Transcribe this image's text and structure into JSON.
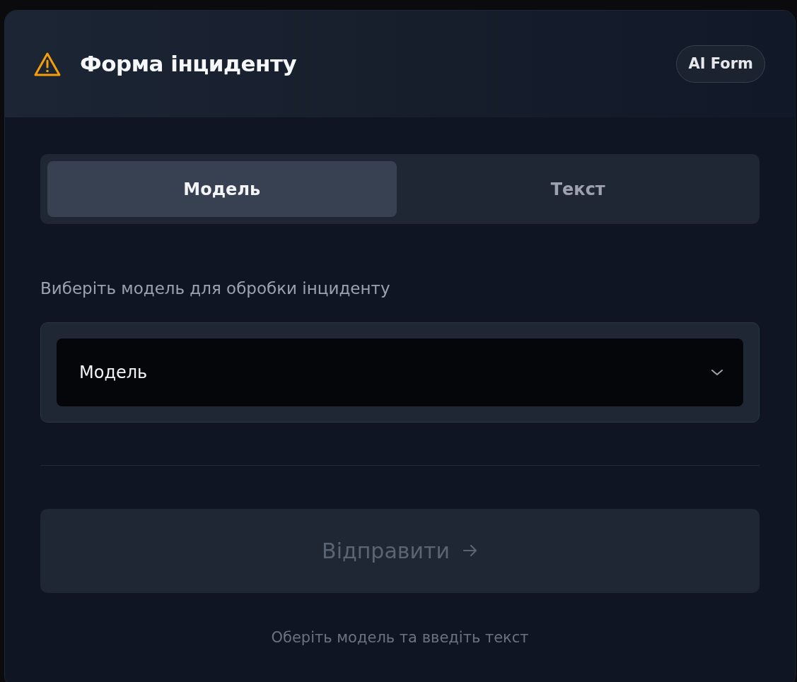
{
  "header": {
    "title": "Форма інциденту",
    "badge": "AI Form"
  },
  "tabs": [
    {
      "label": "Модель",
      "selected": true
    },
    {
      "label": "Текст",
      "selected": false
    }
  ],
  "model_field": {
    "label": "Виберіть модель для обробки інциденту",
    "value": "Модель"
  },
  "submit": {
    "label": "Відправити",
    "disabled": true
  },
  "hint": "Оберіть модель та введіть текст"
}
